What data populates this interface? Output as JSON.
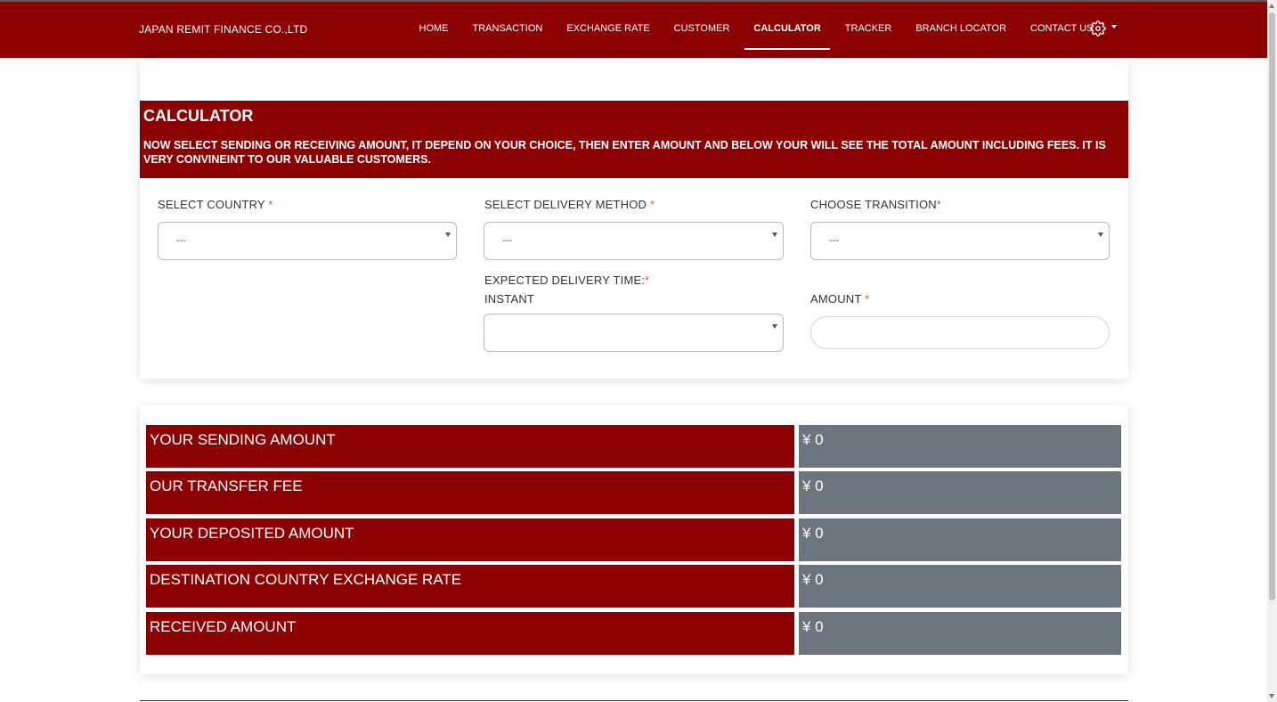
{
  "brand": "JAPAN REMIT FINANCE CO.,LTD",
  "nav": {
    "items": [
      {
        "label": "HOME"
      },
      {
        "label": "TRANSACTION"
      },
      {
        "label": "EXCHANGE RATE"
      },
      {
        "label": "CUSTOMER"
      },
      {
        "label": "CALCULATOR",
        "active": true
      },
      {
        "label": "TRACKER"
      },
      {
        "label": "BRANCH LOCATOR"
      },
      {
        "label": "CONTACT US"
      }
    ],
    "settings_icon": "gear-icon"
  },
  "calculator": {
    "title": "CALCULATOR",
    "description": "NOW SELECT SENDING OR RECEIVING AMOUNT, IT DEPEND ON YOUR CHOICE, THEN ENTER AMOUNT AND BELOW YOUR WILL SEE THE TOTAL AMOUNT INCLUDING FEES. IT IS VERY CONVINEINT TO OUR VALUABLE CUSTOMERS.",
    "country": {
      "label": "SELECT COUNTRY",
      "required": "*",
      "value": "---"
    },
    "delivery_method": {
      "label": "SELECT DELIVERY METHOD",
      "required": "*",
      "value": "---"
    },
    "transition": {
      "label": "CHOOSE TRANSITION",
      "required": "*",
      "value": "---"
    },
    "delivery_time": {
      "label": "EXPECTED DELIVERY TIME:",
      "required": "*",
      "sublabel": "INSTANT",
      "value": ""
    },
    "amount": {
      "label": "AMOUNT",
      "required": "*",
      "value": ""
    }
  },
  "results": {
    "rows": [
      {
        "label": "YOUR SENDING AMOUNT",
        "value": "¥ 0"
      },
      {
        "label": "OUR TRANSFER FEE",
        "value": "¥ 0"
      },
      {
        "label": "YOUR DEPOSITED AMOUNT",
        "value": "¥ 0"
      },
      {
        "label": "DESTINATION COUNTRY EXCHANGE RATE",
        "value": "¥ 0"
      },
      {
        "label": "RECEIVED AMOUNT",
        "value": "¥ 0"
      }
    ]
  },
  "colors": {
    "primary": "#8b0000",
    "value_bg": "#6c757d",
    "required": "#d9534f"
  }
}
